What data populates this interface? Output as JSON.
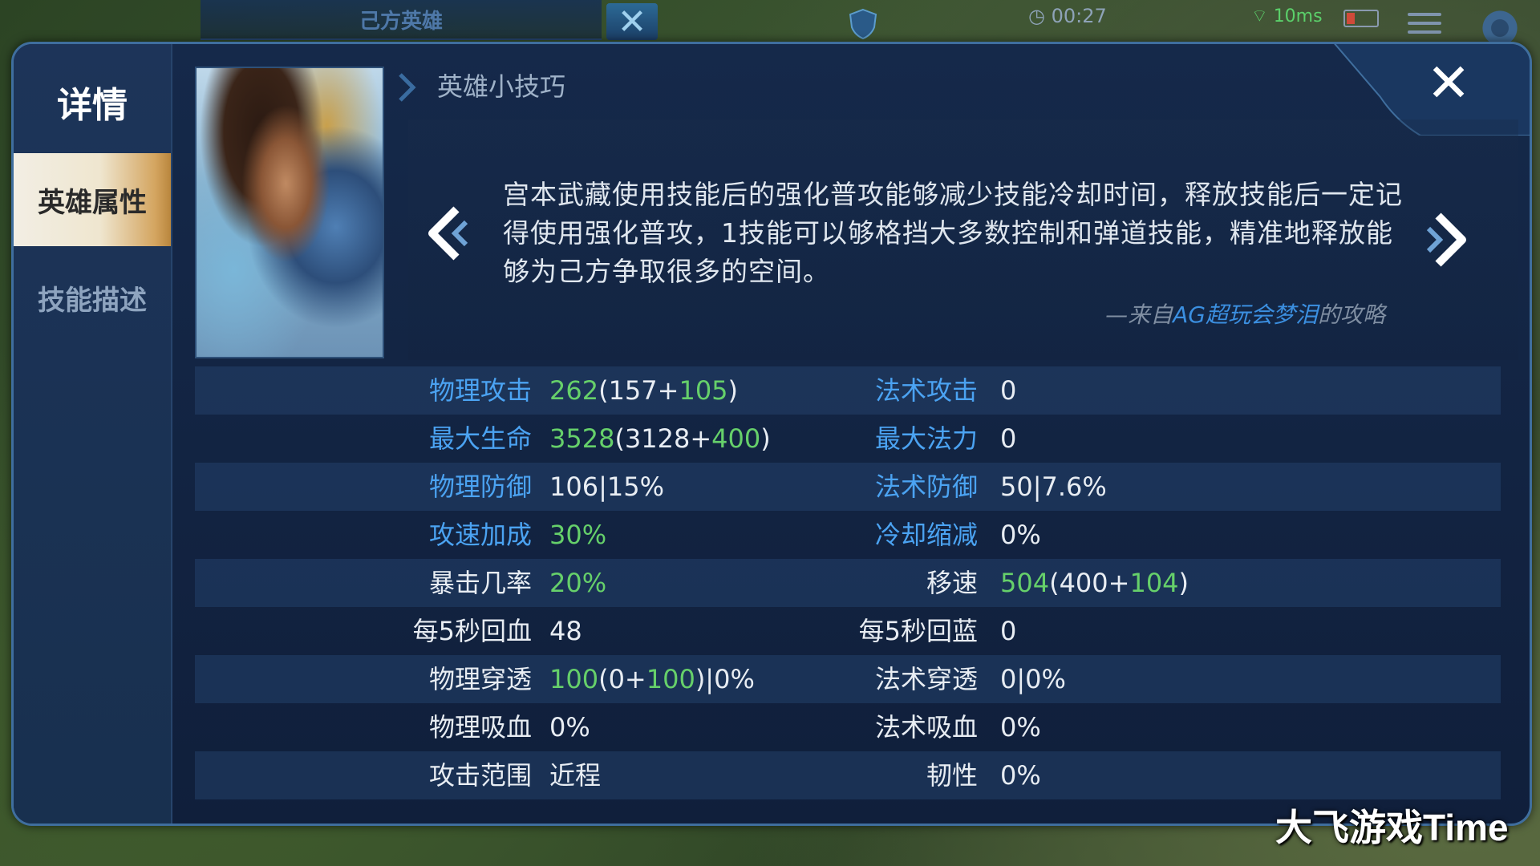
{
  "hud": {
    "team_label": "己方英雄",
    "timer": "00:27",
    "signal": "10ms"
  },
  "sidebar": {
    "title": "详情",
    "tabs": [
      {
        "label": "英雄属性",
        "active": true
      },
      {
        "label": "技能描述",
        "active": false
      }
    ]
  },
  "tip": {
    "header": "英雄小技巧",
    "text": "宫本武藏使用技能后的强化普攻能够减少技能冷却时间，释放技能后一定记得使用强化普攻，1技能可以够格挡大多数控制和弹道技能，精准地释放能够为己方争取很多的空间。",
    "source_prefix": "—来自",
    "source_author": "AG超玩会梦泪",
    "source_suffix": "的攻略"
  },
  "stats": [
    {
      "left": {
        "label": "物理攻击",
        "label_color": "blue",
        "parts": [
          {
            "t": "262",
            "c": "green"
          },
          {
            "t": "(157+",
            "c": "white"
          },
          {
            "t": "105",
            "c": "green"
          },
          {
            "t": ")",
            "c": "white"
          }
        ]
      },
      "right": {
        "label": "法术攻击",
        "label_color": "blue",
        "parts": [
          {
            "t": "0",
            "c": "white"
          }
        ]
      }
    },
    {
      "left": {
        "label": "最大生命",
        "label_color": "blue",
        "parts": [
          {
            "t": "3528",
            "c": "green"
          },
          {
            "t": "(3128+",
            "c": "white"
          },
          {
            "t": "400",
            "c": "green"
          },
          {
            "t": ")",
            "c": "white"
          }
        ]
      },
      "right": {
        "label": "最大法力",
        "label_color": "blue",
        "parts": [
          {
            "t": "0",
            "c": "white"
          }
        ]
      }
    },
    {
      "left": {
        "label": "物理防御",
        "label_color": "blue",
        "parts": [
          {
            "t": "106|15%",
            "c": "white"
          }
        ]
      },
      "right": {
        "label": "法术防御",
        "label_color": "blue",
        "parts": [
          {
            "t": "50|7.6%",
            "c": "white"
          }
        ]
      }
    },
    {
      "left": {
        "label": "攻速加成",
        "label_color": "blue",
        "parts": [
          {
            "t": "30%",
            "c": "green"
          }
        ]
      },
      "right": {
        "label": "冷却缩减",
        "label_color": "blue",
        "parts": [
          {
            "t": "0%",
            "c": "white"
          }
        ]
      }
    },
    {
      "left": {
        "label": "暴击几率",
        "label_color": "white",
        "parts": [
          {
            "t": "20%",
            "c": "green"
          }
        ]
      },
      "right": {
        "label": "移速",
        "label_color": "white",
        "parts": [
          {
            "t": "504",
            "c": "green"
          },
          {
            "t": "(400+",
            "c": "white"
          },
          {
            "t": "104",
            "c": "green"
          },
          {
            "t": ")",
            "c": "white"
          }
        ]
      }
    },
    {
      "left": {
        "label": "每5秒回血",
        "label_color": "white",
        "parts": [
          {
            "t": "48",
            "c": "white"
          }
        ]
      },
      "right": {
        "label": "每5秒回蓝",
        "label_color": "white",
        "parts": [
          {
            "t": "0",
            "c": "white"
          }
        ]
      }
    },
    {
      "left": {
        "label": "物理穿透",
        "label_color": "white",
        "parts": [
          {
            "t": "100",
            "c": "green"
          },
          {
            "t": "(0+",
            "c": "white"
          },
          {
            "t": "100",
            "c": "green"
          },
          {
            "t": ")|0%",
            "c": "white"
          }
        ]
      },
      "right": {
        "label": "法术穿透",
        "label_color": "white",
        "parts": [
          {
            "t": "0|0%",
            "c": "white"
          }
        ]
      }
    },
    {
      "left": {
        "label": "物理吸血",
        "label_color": "white",
        "parts": [
          {
            "t": "0%",
            "c": "white"
          }
        ]
      },
      "right": {
        "label": "法术吸血",
        "label_color": "white",
        "parts": [
          {
            "t": "0%",
            "c": "white"
          }
        ]
      }
    },
    {
      "left": {
        "label": "攻击范围",
        "label_color": "white",
        "parts": [
          {
            "t": "近程",
            "c": "white"
          }
        ]
      },
      "right": {
        "label": "韧性",
        "label_color": "white",
        "parts": [
          {
            "t": "0%",
            "c": "white"
          }
        ]
      }
    }
  ],
  "colors": {
    "blue": "#4ba3f2",
    "green": "#66d06a",
    "white": "#e8edf3",
    "tab_active_gold": "#d4a560"
  },
  "icons": {
    "close": "close-icon",
    "prev": "chevron-left-icon",
    "next": "chevron-right-icon",
    "settings": "gear-icon",
    "menu": "menu-icon"
  },
  "watermark": "大飞游戏Time"
}
